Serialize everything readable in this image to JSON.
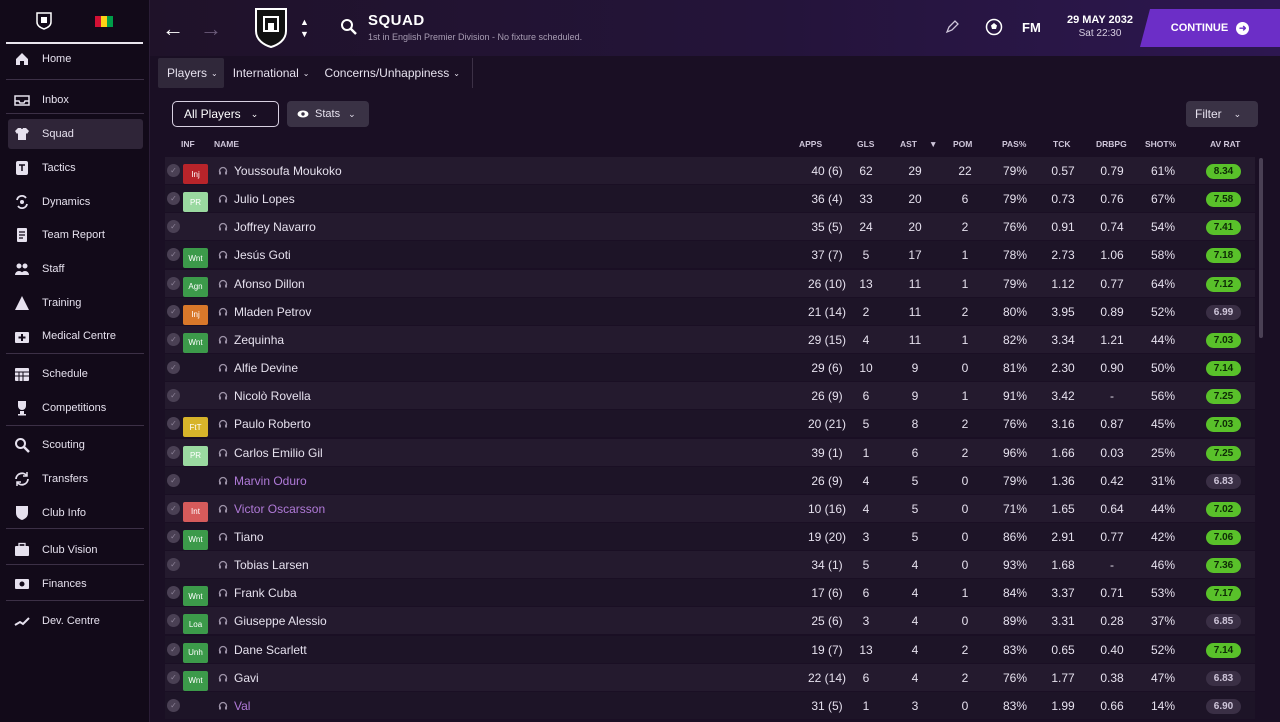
{
  "sidebar": {
    "items": [
      {
        "label": "Home",
        "icon": "home-icon",
        "active": false
      },
      {
        "label": "Inbox",
        "icon": "inbox-icon",
        "active": false
      },
      {
        "label": "Squad",
        "icon": "shirt-icon",
        "active": true
      },
      {
        "label": "Tactics",
        "icon": "tactics-icon",
        "active": false
      },
      {
        "label": "Dynamics",
        "icon": "dynamics-icon",
        "active": false
      },
      {
        "label": "Team Report",
        "icon": "report-icon",
        "active": false
      },
      {
        "label": "Staff",
        "icon": "staff-icon",
        "active": false
      },
      {
        "label": "Training",
        "icon": "training-icon",
        "active": false
      },
      {
        "label": "Medical Centre",
        "icon": "medical-icon",
        "active": false
      },
      {
        "label": "Schedule",
        "icon": "calendar-icon",
        "active": false
      },
      {
        "label": "Competitions",
        "icon": "trophy-icon",
        "active": false
      },
      {
        "label": "Scouting",
        "icon": "search-icon",
        "active": false
      },
      {
        "label": "Transfers",
        "icon": "transfer-icon",
        "active": false
      },
      {
        "label": "Club Info",
        "icon": "shield-icon",
        "active": false
      },
      {
        "label": "Club Vision",
        "icon": "briefcase-icon",
        "active": false
      },
      {
        "label": "Finances",
        "icon": "finances-icon",
        "active": false
      },
      {
        "label": "Dev. Centre",
        "icon": "trend-icon",
        "active": false
      }
    ]
  },
  "header": {
    "title": "SQUAD",
    "subtitle": "1st in English Premier Division - No fixture scheduled.",
    "fm_label": "FM",
    "date": "29 MAY 2032",
    "time": "Sat 22:30",
    "continue_label": "CONTINUE"
  },
  "tabs": [
    {
      "label": "Players",
      "active": true
    },
    {
      "label": "International",
      "active": false
    },
    {
      "label": "Concerns/Unhappiness",
      "active": false
    }
  ],
  "filters": {
    "view_label": "All Players",
    "stats_label": "Stats",
    "filter_label": "Filter"
  },
  "columns": {
    "inf": "INF",
    "name": "NAME",
    "apps": "APPS",
    "gls": "GLS",
    "ast": "AST",
    "pom": "POM",
    "pas": "PAS%",
    "tck": "TCK",
    "drbpg": "DRBPG",
    "shot": "SHOT%",
    "avrat": "AV RAT"
  },
  "colors": {
    "accent": "#6c2ec7",
    "rating_green": "#59c12a",
    "inj_red": "#b8242a",
    "inj_orange": "#d9782a",
    "pr_green": "#9ad9a0",
    "wnt_green": "#3c9a4a",
    "ftt_yellow": "#d7b42a",
    "int_red": "#d65b5b"
  },
  "players": [
    {
      "inf": "Inj",
      "inf_color": "#b8242a",
      "name": "Youssoufa Moukoko",
      "purple": false,
      "apps": "40 (6)",
      "gls": "62",
      "ast": "29",
      "pom": "22",
      "pas": "79%",
      "tck": "0.57",
      "drbpg": "0.79",
      "shot": "61%",
      "avrat": "8.34",
      "green": true
    },
    {
      "inf": "PR",
      "inf_color": "#9ad9a0",
      "name": "Julio Lopes",
      "purple": false,
      "apps": "36 (4)",
      "gls": "33",
      "ast": "20",
      "pom": "6",
      "pas": "79%",
      "tck": "0.73",
      "drbpg": "0.76",
      "shot": "67%",
      "avrat": "7.58",
      "green": true
    },
    {
      "inf": "",
      "inf_color": "",
      "name": "Joffrey Navarro",
      "purple": false,
      "apps": "35 (5)",
      "gls": "24",
      "ast": "20",
      "pom": "2",
      "pas": "76%",
      "tck": "0.91",
      "drbpg": "0.74",
      "shot": "54%",
      "avrat": "7.41",
      "green": true
    },
    {
      "inf": "Wnt",
      "inf_color": "#3c9a4a",
      "name": "Jesús Goti",
      "purple": false,
      "apps": "37 (7)",
      "gls": "5",
      "ast": "17",
      "pom": "1",
      "pas": "78%",
      "tck": "2.73",
      "drbpg": "1.06",
      "shot": "58%",
      "avrat": "7.18",
      "green": true
    },
    {
      "inf": "Agn",
      "inf_color": "#3c9a4a",
      "name": "Afonso Dillon",
      "purple": false,
      "apps": "26 (10)",
      "gls": "13",
      "ast": "11",
      "pom": "1",
      "pas": "79%",
      "tck": "1.12",
      "drbpg": "0.77",
      "shot": "64%",
      "avrat": "7.12",
      "green": true
    },
    {
      "inf": "Inj",
      "inf_color": "#d9782a",
      "name": "Mladen Petrov",
      "purple": false,
      "apps": "21 (14)",
      "gls": "2",
      "ast": "11",
      "pom": "2",
      "pas": "80%",
      "tck": "3.95",
      "drbpg": "0.89",
      "shot": "52%",
      "avrat": "6.99",
      "green": false
    },
    {
      "inf": "Wnt",
      "inf_color": "#3c9a4a",
      "name": "Zequinha",
      "purple": false,
      "apps": "29 (15)",
      "gls": "4",
      "ast": "11",
      "pom": "1",
      "pas": "82%",
      "tck": "3.34",
      "drbpg": "1.21",
      "shot": "44%",
      "avrat": "7.03",
      "green": true
    },
    {
      "inf": "",
      "inf_color": "",
      "name": "Alfie Devine",
      "purple": false,
      "apps": "29 (6)",
      "gls": "10",
      "ast": "9",
      "pom": "0",
      "pas": "81%",
      "tck": "2.30",
      "drbpg": "0.90",
      "shot": "50%",
      "avrat": "7.14",
      "green": true
    },
    {
      "inf": "",
      "inf_color": "",
      "name": "Nicolò Rovella",
      "purple": false,
      "apps": "26 (9)",
      "gls": "6",
      "ast": "9",
      "pom": "1",
      "pas": "91%",
      "tck": "3.42",
      "drbpg": "-",
      "shot": "56%",
      "avrat": "7.25",
      "green": true
    },
    {
      "inf": "FtT",
      "inf_color": "#d7b42a",
      "name": "Paulo Roberto",
      "purple": false,
      "apps": "20 (21)",
      "gls": "5",
      "ast": "8",
      "pom": "2",
      "pas": "76%",
      "tck": "3.16",
      "drbpg": "0.87",
      "shot": "45%",
      "avrat": "7.03",
      "green": true
    },
    {
      "inf": "PR",
      "inf_color": "#9ad9a0",
      "name": "Carlos Emilio Gil",
      "purple": false,
      "apps": "39 (1)",
      "gls": "1",
      "ast": "6",
      "pom": "2",
      "pas": "96%",
      "tck": "1.66",
      "drbpg": "0.03",
      "shot": "25%",
      "avrat": "7.25",
      "green": true
    },
    {
      "inf": "",
      "inf_color": "",
      "name": "Marvin Oduro",
      "purple": true,
      "apps": "26 (9)",
      "gls": "4",
      "ast": "5",
      "pom": "0",
      "pas": "79%",
      "tck": "1.36",
      "drbpg": "0.42",
      "shot": "31%",
      "avrat": "6.83",
      "green": false
    },
    {
      "inf": "Int",
      "inf_color": "#d65b5b",
      "name": "Victor Oscarsson",
      "purple": true,
      "apps": "10 (16)",
      "gls": "4",
      "ast": "5",
      "pom": "0",
      "pas": "71%",
      "tck": "1.65",
      "drbpg": "0.64",
      "shot": "44%",
      "avrat": "7.02",
      "green": true
    },
    {
      "inf": "Wnt",
      "inf_color": "#3c9a4a",
      "name": "Tiano",
      "purple": false,
      "apps": "19 (20)",
      "gls": "3",
      "ast": "5",
      "pom": "0",
      "pas": "86%",
      "tck": "2.91",
      "drbpg": "0.77",
      "shot": "42%",
      "avrat": "7.06",
      "green": true
    },
    {
      "inf": "",
      "inf_color": "",
      "name": "Tobias Larsen",
      "purple": false,
      "apps": "34 (1)",
      "gls": "5",
      "ast": "4",
      "pom": "0",
      "pas": "93%",
      "tck": "1.68",
      "drbpg": "-",
      "shot": "46%",
      "avrat": "7.36",
      "green": true
    },
    {
      "inf": "Wnt",
      "inf_color": "#3c9a4a",
      "name": "Frank Cuba",
      "purple": false,
      "apps": "17 (6)",
      "gls": "6",
      "ast": "4",
      "pom": "1",
      "pas": "84%",
      "tck": "3.37",
      "drbpg": "0.71",
      "shot": "53%",
      "avrat": "7.17",
      "green": true
    },
    {
      "inf": "Loa",
      "inf_color": "#3c9a4a",
      "name": "Giuseppe Alessio",
      "purple": false,
      "apps": "25 (6)",
      "gls": "3",
      "ast": "4",
      "pom": "0",
      "pas": "89%",
      "tck": "3.31",
      "drbpg": "0.28",
      "shot": "37%",
      "avrat": "6.85",
      "green": false
    },
    {
      "inf": "Unh",
      "inf_color": "#3c9a4a",
      "name": "Dane Scarlett",
      "purple": false,
      "apps": "19 (7)",
      "gls": "13",
      "ast": "4",
      "pom": "2",
      "pas": "83%",
      "tck": "0.65",
      "drbpg": "0.40",
      "shot": "52%",
      "avrat": "7.14",
      "green": true
    },
    {
      "inf": "Wnt",
      "inf_color": "#3c9a4a",
      "name": "Gavi",
      "purple": false,
      "apps": "22 (14)",
      "gls": "6",
      "ast": "4",
      "pom": "2",
      "pas": "76%",
      "tck": "1.77",
      "drbpg": "0.38",
      "shot": "47%",
      "avrat": "6.83",
      "green": false
    },
    {
      "inf": "",
      "inf_color": "",
      "name": "Val",
      "purple": true,
      "apps": "31 (5)",
      "gls": "1",
      "ast": "3",
      "pom": "0",
      "pas": "83%",
      "tck": "1.99",
      "drbpg": "0.66",
      "shot": "14%",
      "avrat": "6.90",
      "green": false
    }
  ]
}
